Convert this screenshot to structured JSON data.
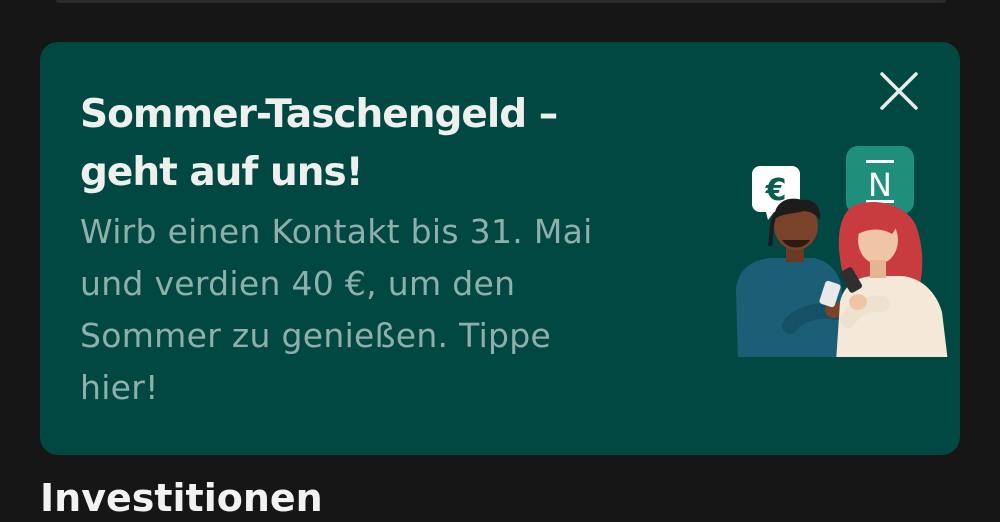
{
  "promo": {
    "title_line1": "Sommer-Taschengeld –",
    "title_line2": "geht auf uns!",
    "body_line1": "Wirb einen Kontakt bis 31. Mai",
    "body_line2": "und verdien 40 €, um den",
    "body_line3": "Sommer zu genießen. Tippe",
    "body_line4": "hier!",
    "euro_symbol": "€",
    "app_logo_letter": "N",
    "close_icon": "close-icon",
    "colors": {
      "card_background": "#024842",
      "title": "#eef0ee",
      "body": "#8fb0aa",
      "logo_badge": "#1f8e7b"
    }
  },
  "next_section": {
    "heading_partial": "Investitionen"
  }
}
